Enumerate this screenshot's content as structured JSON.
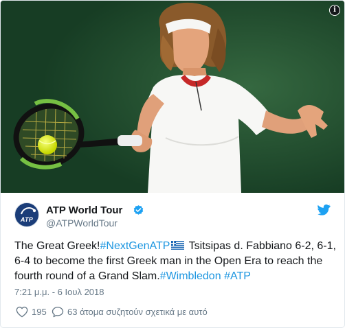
{
  "author": {
    "name": "ATP World Tour",
    "handle": "@ATPWorldTour",
    "avatar_text": "ATP"
  },
  "tweet": {
    "intro": "The Great Greek!",
    "hashtag_1": "#NextGenATP",
    "body": " Tsitsipas d. Fabbiano 6-2, 6-1, 6-4 to become the first Greek man in the Open Era to reach the fourth round of a Grand Slam.",
    "hashtag_2": "#Wimbledon",
    "hashtag_3": "#ATP"
  },
  "timestamp": "7:21 μ.μ. - 6 Ιουλ 2018",
  "actions": {
    "like_count": "195",
    "reply_label": "63 άτομα συζητούν σχετικά με αυτό"
  },
  "icons": {
    "info": "info-icon",
    "verified": "verified-badge-icon",
    "brand": "twitter-bird-icon",
    "like": "heart-icon",
    "reply": "speech-bubble-icon",
    "flag": "greek-flag-icon"
  },
  "colors": {
    "link": "#1b95e0",
    "verified": "#1da1f2",
    "secondary_text": "#657786",
    "primary_text": "#14171a"
  }
}
